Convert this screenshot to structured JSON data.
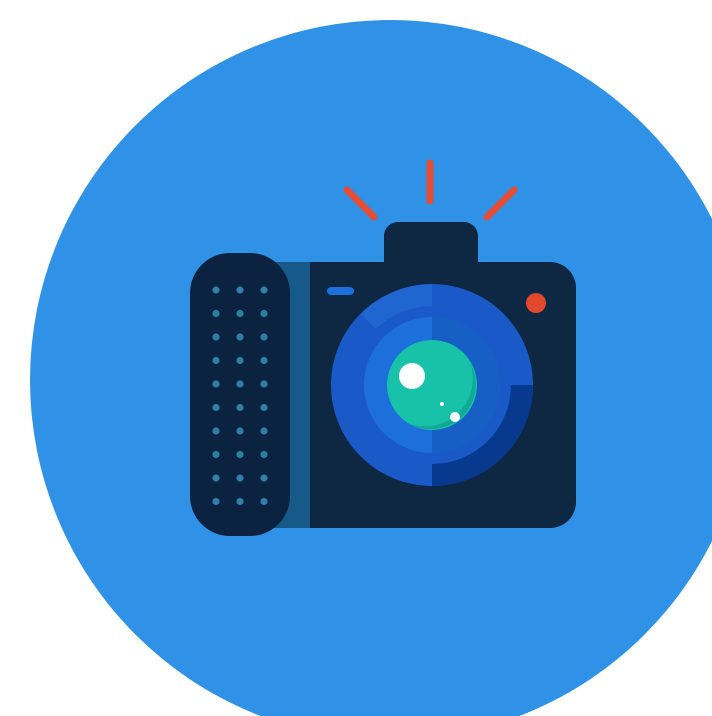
{
  "illustration": {
    "subject": "camera-icon",
    "colors": {
      "background": "#ffffff",
      "circle": "#3092e6",
      "body": "#0e2742",
      "grip": "#0b2340",
      "grip_shadow": "#165a8a",
      "grip_dots": "#2f7fa5",
      "flash_rays": "#e44d36",
      "indicator_light": "#e1492f",
      "lens_outer": "#1a59c8",
      "lens_ring_dark": "#073a8f",
      "lens_inner": "#1d70db",
      "lens_glass": "#17c2a8",
      "lens_highlight": "#ffffff"
    }
  }
}
